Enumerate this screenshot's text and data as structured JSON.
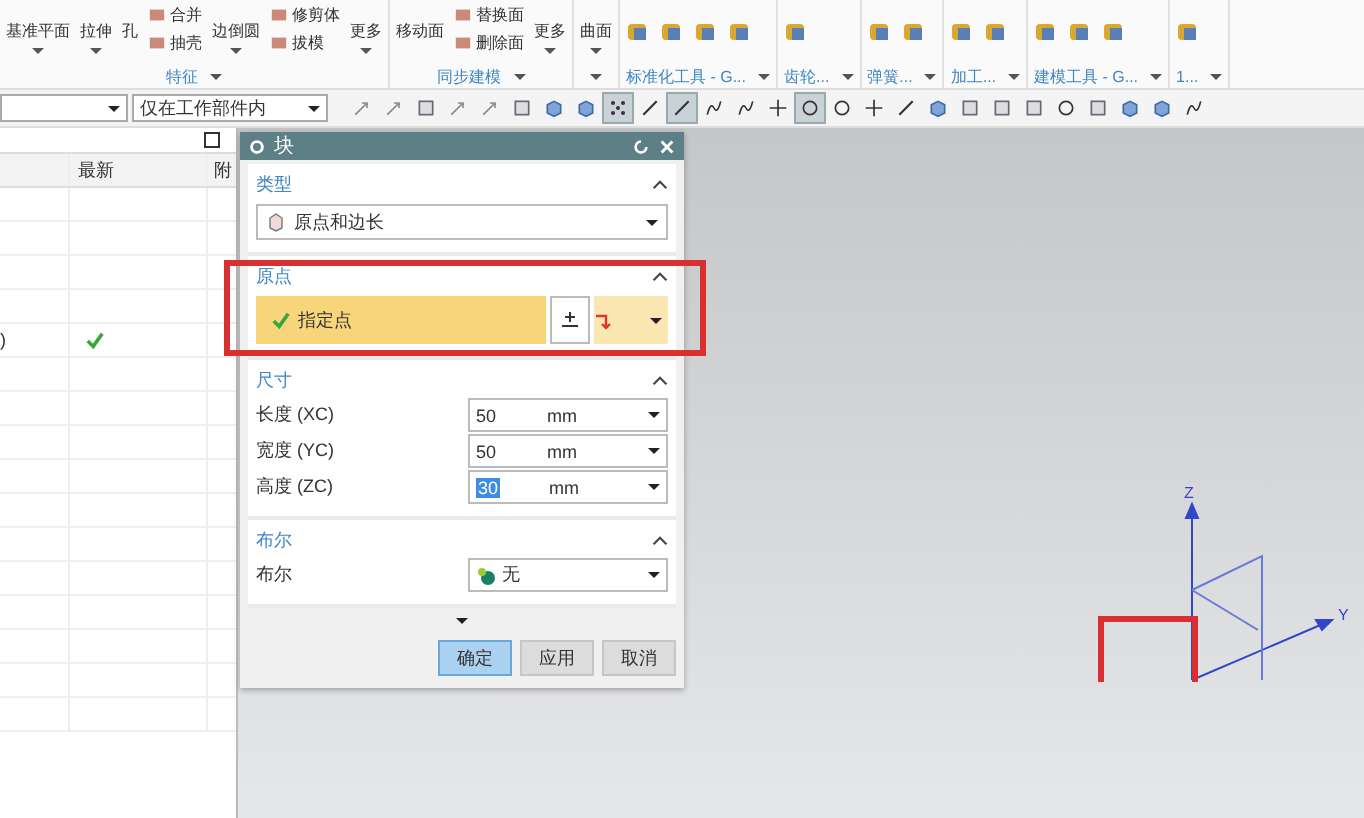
{
  "ribbon": {
    "groups": [
      {
        "label": "特征",
        "columns": [
          {
            "kind": "large",
            "label": "基准平面",
            "menu": true
          },
          {
            "kind": "large",
            "label": "拉伸",
            "menu": true
          },
          {
            "kind": "large",
            "label": "孔",
            "menu": false
          },
          {
            "kind": "small",
            "items": [
              "合并",
              "抽壳"
            ]
          },
          {
            "kind": "large",
            "label": "边倒圆",
            "menu": true
          },
          {
            "kind": "small",
            "items": [
              "修剪体",
              "拔模"
            ]
          },
          {
            "kind": "large",
            "label": "更多",
            "menu": true
          }
        ]
      },
      {
        "label": "同步建模",
        "columns": [
          {
            "kind": "large",
            "label": "移动面",
            "menu": false
          },
          {
            "kind": "small",
            "items": [
              "替换面",
              "删除面"
            ]
          },
          {
            "kind": "large",
            "label": "更多",
            "menu": true
          }
        ]
      },
      {
        "columns": [
          {
            "kind": "large",
            "label": "曲面",
            "menu": true
          }
        ]
      },
      {
        "label": "标准化工具 - G...",
        "columns": [
          {
            "kind": "icon"
          },
          {
            "kind": "icon"
          },
          {
            "kind": "icon"
          },
          {
            "kind": "icon"
          }
        ]
      },
      {
        "label": "齿轮...",
        "columns": [
          {
            "kind": "icon"
          }
        ]
      },
      {
        "label": "弹簧...",
        "columns": [
          {
            "kind": "icon"
          },
          {
            "kind": "icon"
          }
        ]
      },
      {
        "label": "加工...",
        "columns": [
          {
            "kind": "icon"
          },
          {
            "kind": "icon"
          }
        ]
      },
      {
        "label": "建模工具 - G...",
        "columns": [
          {
            "kind": "icon"
          },
          {
            "kind": "icon"
          },
          {
            "kind": "icon"
          }
        ]
      },
      {
        "label": "1...",
        "columns": [
          {
            "kind": "icon"
          }
        ]
      }
    ]
  },
  "selection_bar": {
    "scope": "仅在工作部件内",
    "tools": [
      {
        "kind": "arrow",
        "selected": false
      },
      {
        "kind": "arrow",
        "selected": false
      },
      {
        "kind": "square",
        "selected": false
      },
      {
        "kind": "arrow",
        "selected": false
      },
      {
        "kind": "arrow",
        "selected": false
      },
      {
        "kind": "square",
        "selected": false
      },
      {
        "kind": "cube",
        "selected": false
      },
      {
        "kind": "cube",
        "selected": false
      },
      {
        "kind": "dots",
        "selected": true
      },
      {
        "kind": "line",
        "selected": false
      },
      {
        "kind": "line",
        "selected": true
      },
      {
        "kind": "curve",
        "selected": false
      },
      {
        "kind": "curve",
        "selected": false
      },
      {
        "kind": "cross",
        "selected": false
      },
      {
        "kind": "circle",
        "selected": true
      },
      {
        "kind": "circle",
        "selected": false
      },
      {
        "kind": "cross",
        "selected": false
      },
      {
        "kind": "line",
        "selected": false
      },
      {
        "kind": "cube",
        "selected": false
      },
      {
        "kind": "square",
        "selected": false
      },
      {
        "kind": "square",
        "selected": false
      },
      {
        "kind": "square",
        "selected": false
      },
      {
        "kind": "circle",
        "selected": false
      },
      {
        "kind": "square",
        "selected": false
      },
      {
        "kind": "cube",
        "selected": false
      },
      {
        "kind": "cube",
        "selected": false
      },
      {
        "kind": "curve",
        "selected": false
      }
    ]
  },
  "navigator": {
    "columns": [
      "最新",
      "附"
    ],
    "rows": [
      {
        "latest": false
      },
      {
        "latest": false
      },
      {
        "latest": false
      },
      {
        "latest": false
      },
      {
        "name": ")",
        "latest": true
      },
      {
        "latest": false
      },
      {
        "latest": false
      },
      {
        "latest": false
      },
      {
        "latest": false
      },
      {
        "latest": false
      },
      {
        "latest": false
      },
      {
        "latest": false
      },
      {
        "latest": false
      },
      {
        "latest": false
      },
      {
        "latest": false
      },
      {
        "latest": false
      }
    ]
  },
  "dialog": {
    "title": "块",
    "sections": [
      {
        "kind": "type",
        "title": "类型",
        "expanded": true,
        "value": "原点和边长"
      },
      {
        "kind": "point",
        "title": "原点",
        "expanded": true,
        "label": "指定点",
        "done": true
      },
      {
        "kind": "dims",
        "title": "尺寸",
        "expanded": true,
        "fields": [
          {
            "label": "长度 (XC)",
            "value": "50",
            "unit": "mm",
            "selected": false
          },
          {
            "label": "宽度 (YC)",
            "value": "50",
            "unit": "mm",
            "selected": false
          },
          {
            "label": "高度 (ZC)",
            "value": "30",
            "unit": "mm",
            "selected": true
          }
        ]
      },
      {
        "kind": "bool",
        "title": "布尔",
        "expanded": true,
        "label": "布尔",
        "value": "无"
      }
    ],
    "buttons": [
      {
        "label": "确定",
        "default": true
      },
      {
        "label": "应用",
        "default": false
      },
      {
        "label": "取消",
        "default": false
      }
    ]
  },
  "viewport": {
    "axis_labels": [
      "Z",
      "Y"
    ]
  }
}
